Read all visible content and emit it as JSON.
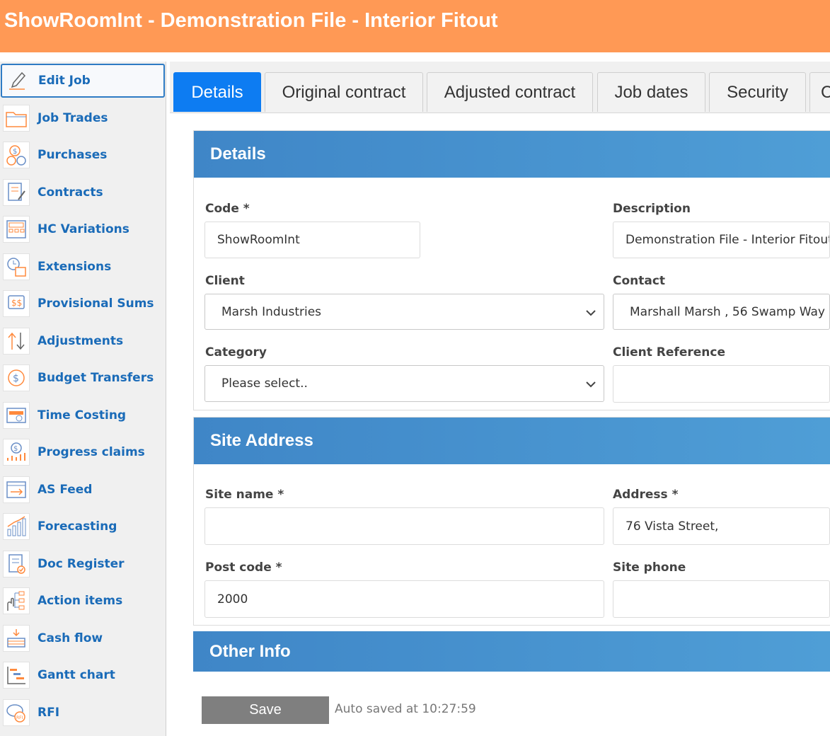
{
  "app": {
    "title": "ShowRoomInt - Demonstration File - Interior Fitout",
    "header_color": "#ff9955"
  },
  "sidebar": {
    "items": [
      {
        "label": "Edit Job",
        "icon": "pencil-icon",
        "active": true
      },
      {
        "label": "Job Trades",
        "icon": "folder-icon"
      },
      {
        "label": "Purchases",
        "icon": "coins-icon"
      },
      {
        "label": "Contracts",
        "icon": "contract-icon"
      },
      {
        "label": "HC Variations",
        "icon": "calculator-icon"
      },
      {
        "label": "Extensions",
        "icon": "clock-calendar-icon"
      },
      {
        "label": "Provisional Sums",
        "icon": "dollar-chat-icon"
      },
      {
        "label": "Adjustments",
        "icon": "up-down-arrows-icon"
      },
      {
        "label": "Budget Transfers",
        "icon": "dollar-transfer-icon"
      },
      {
        "label": "Time Costing",
        "icon": "time-costing-icon"
      },
      {
        "label": "Progress claims",
        "icon": "progress-claim-icon"
      },
      {
        "label": "AS Feed",
        "icon": "feed-icon"
      },
      {
        "label": "Forecasting",
        "icon": "bar-chart-icon"
      },
      {
        "label": "Doc Register",
        "icon": "document-check-icon"
      },
      {
        "label": "Action items",
        "icon": "hand-tree-icon"
      },
      {
        "label": "Cash flow",
        "icon": "cash-stack-icon"
      },
      {
        "label": "Gantt chart",
        "icon": "gantt-icon"
      },
      {
        "label": "RFI",
        "icon": "rfi-chat-icon"
      }
    ]
  },
  "tabs": [
    {
      "label": "Details",
      "active": true
    },
    {
      "label": "Original contract"
    },
    {
      "label": "Adjusted contract"
    },
    {
      "label": "Job dates"
    },
    {
      "label": "Security"
    },
    {
      "label": "C"
    }
  ],
  "details": {
    "title": "Details",
    "code_label": "Code *",
    "code_value": "ShowRoomInt",
    "description_label": "Description",
    "description_value": "Demonstration File - Interior Fitout",
    "client_label": "Client",
    "client_value": "Marsh Industries",
    "contact_label": "Contact",
    "contact_value": "Marshall Marsh , 56 Swamp Way",
    "category_label": "Category",
    "category_value": "Please select..",
    "client_ref_label": "Client Reference",
    "client_ref_value": ""
  },
  "site": {
    "title": "Site Address",
    "site_name_label": "Site name *",
    "site_name_value": "",
    "address_label": "Address *",
    "address_value": "76 Vista Street,",
    "postcode_label": "Post code *",
    "postcode_value": "2000",
    "phone_label": "Site phone",
    "phone_value": ""
  },
  "other": {
    "title": "Other Info"
  },
  "footer": {
    "save_label": "Save",
    "autosave_text": "Auto saved at 10:27:59"
  },
  "colors": {
    "accent": "#0d7cf2",
    "panel_header": "#4a93d0",
    "link": "#1a6bb8",
    "save_button": "#7f7f7f"
  }
}
